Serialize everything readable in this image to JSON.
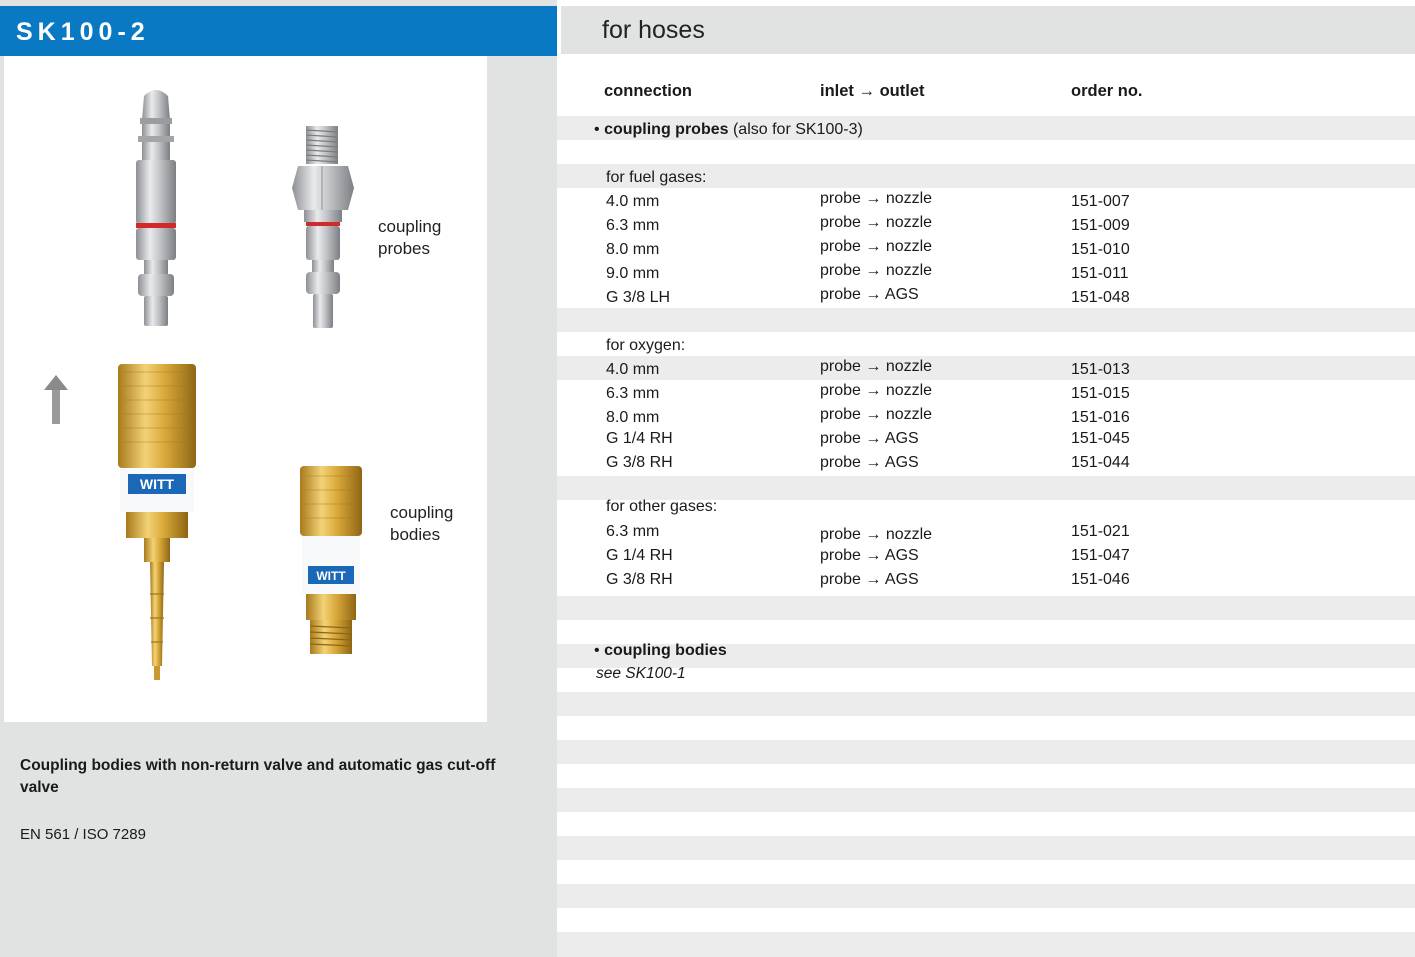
{
  "left": {
    "product_code": "SK100-2",
    "probes_label_line1": "coupling",
    "probes_label_line2": "probes",
    "bodies_label_line1": "coupling",
    "bodies_label_line2": "bodies",
    "witt_logo_text": "WITT",
    "description_title": "Coupling bodies with non-return valve and automatic gas cut-off valve",
    "standard": "EN 561 / ISO 7289"
  },
  "right": {
    "section_title": "for hoses",
    "columns": {
      "connection": "connection",
      "inlet_outlet": "inlet → outlet",
      "order_no": "order no."
    },
    "probes_group": {
      "bullet": "•",
      "title": "coupling probes",
      "note": "(also for SK100-3)"
    },
    "categories": {
      "fuel": "for fuel gases:",
      "oxygen": "for oxygen:",
      "other": "for other gases:"
    },
    "fuel_rows": [
      {
        "connection": "4.0 mm",
        "flow": "probe → nozzle",
        "order": "151-007"
      },
      {
        "connection": "6.3 mm",
        "flow": "probe → nozzle",
        "order": "151-009"
      },
      {
        "connection": "8.0 mm",
        "flow": "probe → nozzle",
        "order": "151-010"
      },
      {
        "connection": "9.0 mm",
        "flow": "probe → nozzle",
        "order": "151-011"
      },
      {
        "connection": "G 3/8 LH",
        "flow": "probe → AGS",
        "order": "151-048"
      }
    ],
    "oxygen_rows": [
      {
        "connection": "4.0 mm",
        "flow": "probe → nozzle",
        "order": "151-013"
      },
      {
        "connection": "6.3 mm",
        "flow": "probe → nozzle",
        "order": "151-015"
      },
      {
        "connection": "8.0 mm",
        "flow": "probe → nozzle",
        "order": "151-016"
      },
      {
        "connection": "G 1/4 RH",
        "flow": "probe → AGS",
        "order": "151-045"
      },
      {
        "connection": "G 3/8 RH",
        "flow": "probe → AGS",
        "order": "151-044"
      }
    ],
    "other_rows": [
      {
        "connection": "6.3 mm",
        "flow": "probe → nozzle",
        "order": "151-021"
      },
      {
        "connection": "G 1/4 RH",
        "flow": "probe → AGS",
        "order": "151-047"
      },
      {
        "connection": "G 3/8 RH",
        "flow": "probe → AGS",
        "order": "151-046"
      }
    ],
    "bodies_group": {
      "bullet": "•",
      "title": "coupling bodies",
      "see": "see SK100-1"
    }
  },
  "colors": {
    "brand_blue": "#0a79c4",
    "panel_gray": "#e1e3e2",
    "stripe_gray": "#ececec",
    "probe_ring_red": "#d12a2a",
    "brass": "#d9a93a"
  }
}
